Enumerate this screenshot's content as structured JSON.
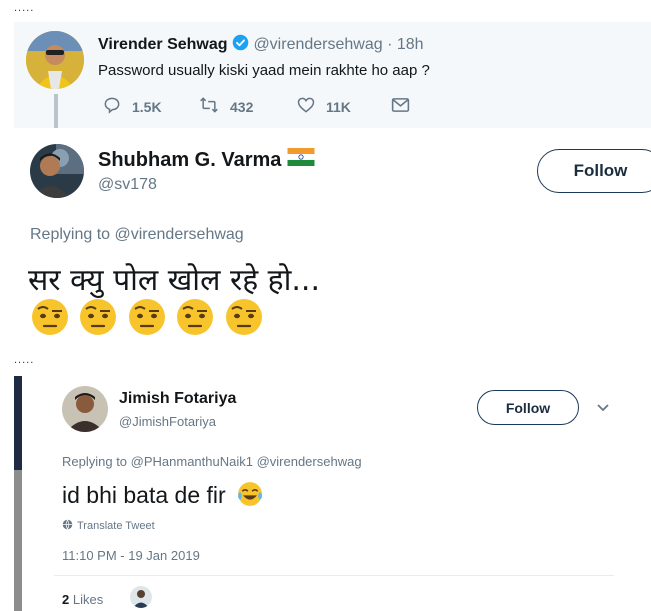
{
  "separator_dots": ".....",
  "sehwag_tweet": {
    "name": "Virender Sehwag",
    "handle": "@virendersehwag",
    "time": "· 18h",
    "text": "Password usually kiski yaad mein rakhte ho aap ?",
    "replies": "1.5K",
    "retweets": "432",
    "likes": "11K"
  },
  "shubham_reply": {
    "name": "Shubham G. Varma",
    "handle": "@sv178",
    "follow_label": "Follow",
    "replying_to": "Replying to @virendersehwag",
    "text": "सर क्यु पोल खोल रहे हो...",
    "emoji_count": 5
  },
  "jimish_reply": {
    "name": "Jimish Fotariya",
    "handle": "@JimishFotariya",
    "follow_label": "Follow",
    "replying_to": "Replying to @PHanmanthuNaik1 @virendersehwag",
    "text": "id bhi bata de fir",
    "translate_label": "Translate Tweet",
    "timestamp": "11:10 PM - 19 Jan 2019",
    "likes_count": "2",
    "likes_label": "Likes"
  },
  "colors": {
    "verified_blue": "#1da1f2",
    "muted_gray": "#657786",
    "card_bg": "#f5f8fa",
    "follow_border": "#1b3a5a",
    "left_bar_dark": "#1f2a44",
    "left_bar_gray": "#8d8d8d"
  }
}
